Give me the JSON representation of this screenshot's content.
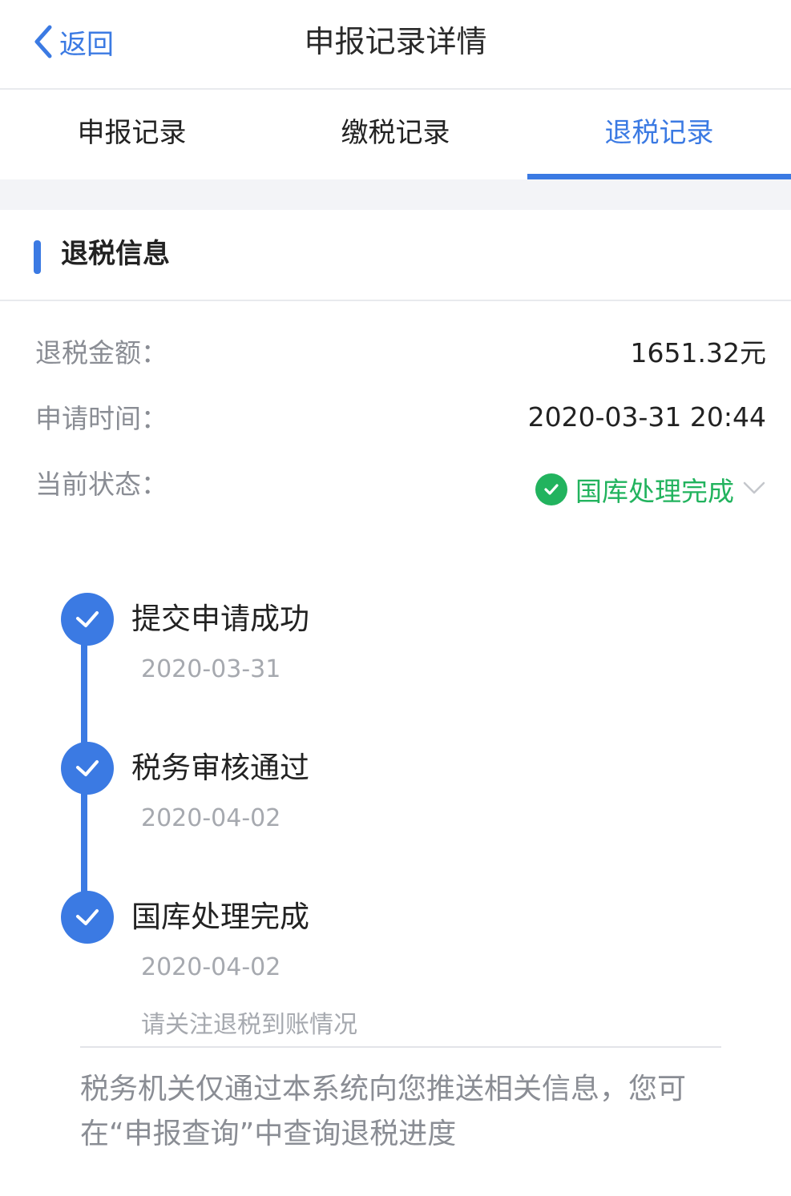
{
  "header": {
    "back_label": "返回",
    "title": "申报记录详情"
  },
  "tabs": [
    {
      "label": "申报记录",
      "active": false
    },
    {
      "label": "缴税记录",
      "active": false
    },
    {
      "label": "退税记录",
      "active": true
    }
  ],
  "section": {
    "title": "退税信息"
  },
  "info": {
    "amount_label": "退税金额：",
    "amount_value": "1651.32元",
    "time_label": "申请时间：",
    "time_value": "2020-03-31 20:44",
    "status_label": "当前状态：",
    "status_value": "国库处理完成"
  },
  "timeline": [
    {
      "title": "提交申请成功",
      "date": "2020-03-31"
    },
    {
      "title": "税务审核通过",
      "date": "2020-04-02"
    },
    {
      "title": "国库处理完成",
      "date": "2020-04-02",
      "note": "请关注退税到账情况"
    }
  ],
  "notice": "税务机关仅通过本系统向您推送相关信息，您可在“申报查询”中查询退税进度",
  "colors": {
    "accent": "#3b7ae3",
    "success": "#22b35e"
  },
  "icons": {
    "back": "chevron-left-icon",
    "status": "check-circle-icon",
    "expand": "chevron-down-icon",
    "step": "check-icon"
  }
}
